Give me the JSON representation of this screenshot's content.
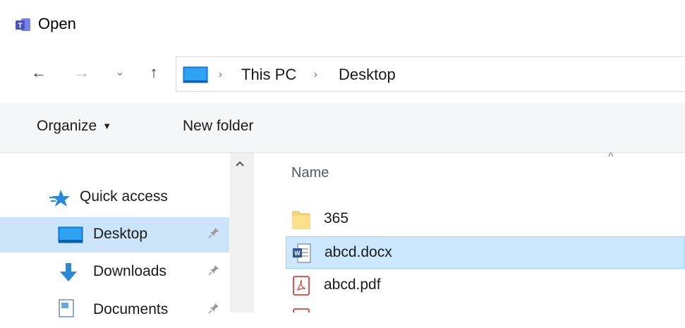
{
  "window": {
    "title": "Open"
  },
  "nav": {
    "back_glyph": "←",
    "forward_glyph": "→",
    "recent_glyph": "⌄",
    "up_glyph": "↑"
  },
  "address": {
    "crumbs": [
      "This PC",
      "Desktop"
    ],
    "separator": "›"
  },
  "toolbar": {
    "organize_label": "Organize",
    "organize_caret": "▼",
    "new_folder_label": "New folder"
  },
  "sidebar": {
    "items": [
      {
        "label": "Quick access",
        "icon": "star-icon",
        "pinned": false,
        "selected": false
      },
      {
        "label": "Desktop",
        "icon": "desktop-icon",
        "pinned": true,
        "selected": true
      },
      {
        "label": "Downloads",
        "icon": "download-icon",
        "pinned": true,
        "selected": false
      },
      {
        "label": "Documents",
        "icon": "documents-icon",
        "pinned": true,
        "selected": false
      }
    ],
    "pin_glyph": "📌"
  },
  "file_list": {
    "column_name": "Name",
    "sort_indicator": "^",
    "files": [
      {
        "name": "365",
        "icon": "folder-icon",
        "selected": false
      },
      {
        "name": "abcd.docx",
        "icon": "word-doc-icon",
        "selected": true
      },
      {
        "name": "abcd.pdf",
        "icon": "pdf-icon",
        "selected": false
      },
      {
        "name": "",
        "icon": "pdf-icon",
        "selected": false
      }
    ]
  },
  "colors": {
    "accent": "#0078d7",
    "selection": "#cce8ff",
    "nav_selection": "#cce4f7",
    "toolbar_bg": "#f5f6f7"
  }
}
